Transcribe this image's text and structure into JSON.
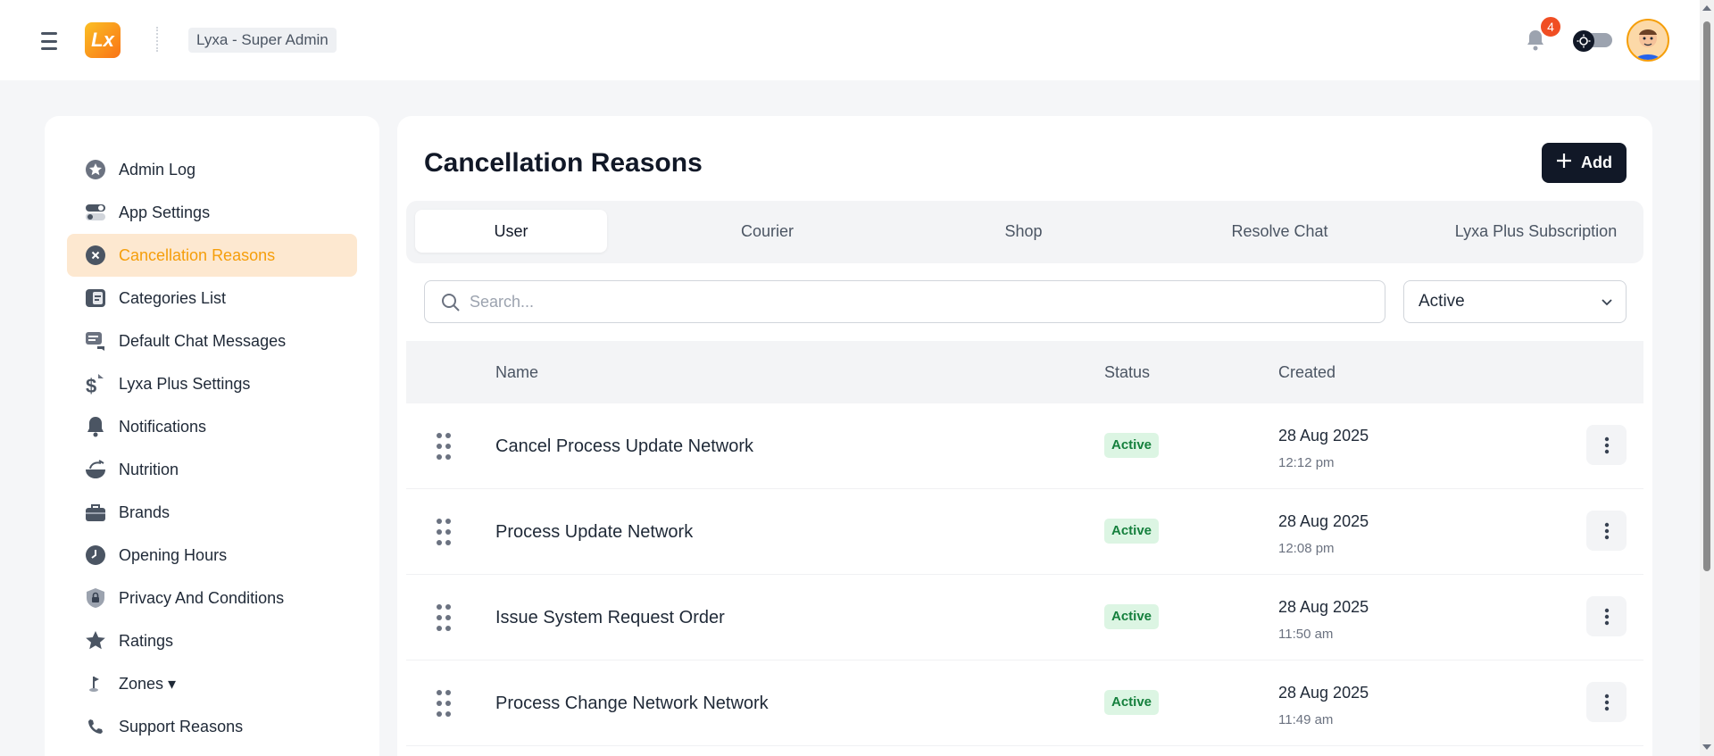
{
  "header": {
    "logo_text": "Lx",
    "role_label": "Lyxa - Super Admin",
    "notification_count": "4"
  },
  "sidebar": {
    "items": [
      {
        "label": "Admin Log",
        "icon": "star-badge-icon"
      },
      {
        "label": "App Settings",
        "icon": "toggles-icon"
      },
      {
        "label": "Cancellation Reasons",
        "icon": "x-circle-icon",
        "active": true
      },
      {
        "label": "Categories List",
        "icon": "category-list-icon"
      },
      {
        "label": "Default Chat Messages",
        "icon": "chat-icon"
      },
      {
        "label": "Lyxa Plus Settings",
        "icon": "dollar-icon"
      },
      {
        "label": "Notifications",
        "icon": "bell-icon"
      },
      {
        "label": "Nutrition",
        "icon": "food-icon"
      },
      {
        "label": "Brands",
        "icon": "briefcase-icon"
      },
      {
        "label": "Opening Hours",
        "icon": "clock-icon"
      },
      {
        "label": "Privacy And Conditions",
        "icon": "lock-shield-icon"
      },
      {
        "label": "Ratings",
        "icon": "star-icon"
      },
      {
        "label": "Zones ▾",
        "icon": "flag-icon"
      },
      {
        "label": "Support Reasons",
        "icon": "phone-icon"
      }
    ]
  },
  "main": {
    "title": "Cancellation Reasons",
    "add_label": "Add",
    "tabs": [
      {
        "label": "User",
        "active": true
      },
      {
        "label": "Courier"
      },
      {
        "label": "Shop"
      },
      {
        "label": "Resolve Chat"
      },
      {
        "label": "Lyxa Plus Subscription"
      }
    ],
    "search": {
      "placeholder": "Search...",
      "value": ""
    },
    "status_filter": {
      "selected": "Active"
    },
    "table": {
      "columns": [
        "Name",
        "Status",
        "Created"
      ],
      "rows": [
        {
          "name": "Cancel Process Update Network",
          "status": "Active",
          "date": "28 Aug 2025",
          "time": "12:12 pm"
        },
        {
          "name": "Process Update Network",
          "status": "Active",
          "date": "28 Aug 2025",
          "time": "12:08 pm"
        },
        {
          "name": "Issue System Request Order",
          "status": "Active",
          "date": "28 Aug 2025",
          "time": "11:50 am"
        },
        {
          "name": "Process Change Network Network",
          "status": "Active",
          "date": "28 Aug 2025",
          "time": "11:49 am"
        }
      ]
    }
  },
  "colors": {
    "accent": "#f59e0b",
    "active_bg": "#fde8d0",
    "status_green": "#15803d",
    "dark_button": "#111827"
  }
}
